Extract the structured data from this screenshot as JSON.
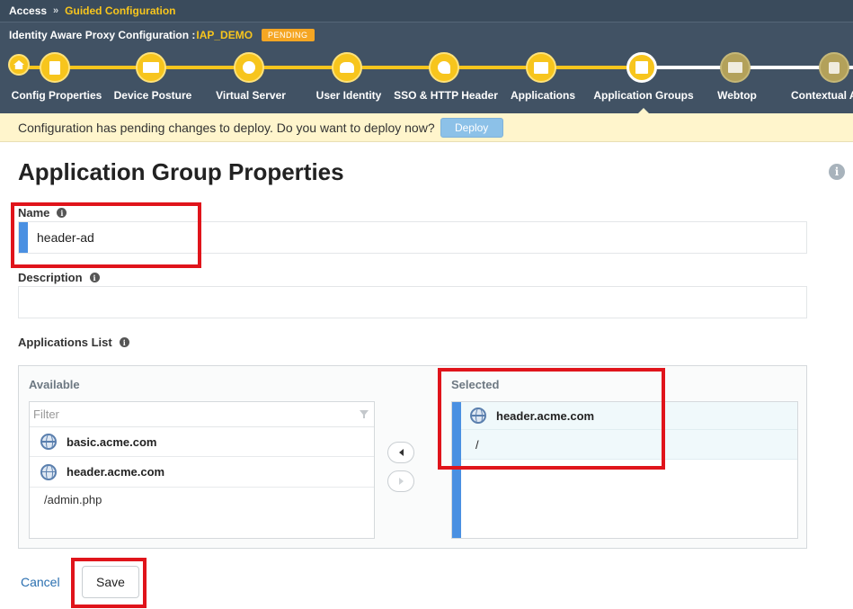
{
  "breadcrumb": {
    "root": "Access",
    "separator": "»",
    "current": "Guided Configuration"
  },
  "titlebar": {
    "title": "Identity Aware Proxy Configuration :",
    "config_name": "IAP_DEMO",
    "status_badge": "PENDING"
  },
  "wizard": {
    "steps": [
      {
        "label": "Config Properties",
        "icon": "document-icon",
        "state": "done"
      },
      {
        "label": "Device Posture",
        "icon": "id-card-icon",
        "state": "done"
      },
      {
        "label": "Virtual Server",
        "icon": "globe-icon",
        "state": "done"
      },
      {
        "label": "User Identity",
        "icon": "users-icon",
        "state": "done"
      },
      {
        "label": "SSO & HTTP Header",
        "icon": "key-icon",
        "state": "done"
      },
      {
        "label": "Applications",
        "icon": "window-icon",
        "state": "done"
      },
      {
        "label": "Application Groups",
        "icon": "app-group-icon",
        "state": "current"
      },
      {
        "label": "Webtop",
        "icon": "monitor-icon",
        "state": "todo"
      },
      {
        "label": "Contextual A",
        "icon": "lock-icon",
        "state": "todo"
      }
    ]
  },
  "notice": {
    "text": "Configuration has pending changes to deploy. Do you want to deploy now?",
    "deploy_label": "Deploy"
  },
  "page": {
    "title": "Application Group Properties"
  },
  "form": {
    "name": {
      "label": "Name",
      "value": "header-ad"
    },
    "description": {
      "label": "Description",
      "value": ""
    },
    "applications_list": {
      "label": "Applications List",
      "available": {
        "title": "Available",
        "filter_placeholder": "Filter",
        "items": [
          {
            "name": "basic.acme.com",
            "paths": []
          },
          {
            "name": "header.acme.com",
            "paths": [
              "/admin.php"
            ]
          }
        ]
      },
      "selected": {
        "title": "Selected",
        "items": [
          {
            "name": "header.acme.com",
            "paths": [
              "/"
            ]
          }
        ]
      }
    }
  },
  "footer": {
    "cancel_label": "Cancel",
    "save_label": "Save"
  },
  "colors": {
    "accent_yellow": "#f7c51d",
    "header_bg": "#415264",
    "highlight_red": "#e0141b",
    "required_blue": "#4a90e2"
  }
}
